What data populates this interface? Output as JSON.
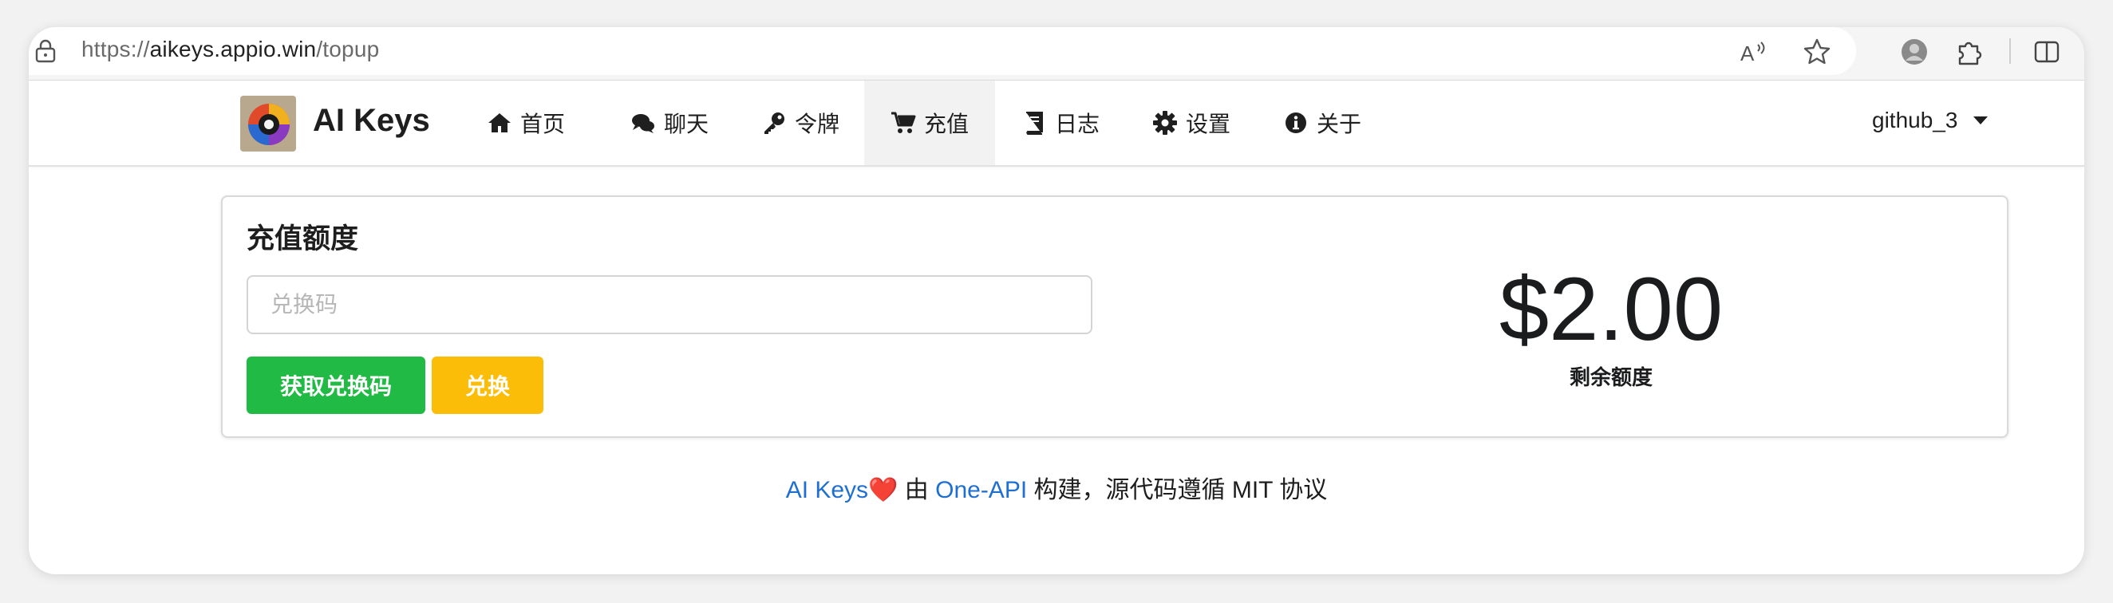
{
  "browser": {
    "url_scheme": "https://",
    "url_host": "aikeys.appio.win",
    "url_path": "/topup",
    "icons": [
      "lock-icon",
      "read-aloud-icon",
      "favorite-star-icon",
      "profile-avatar-icon",
      "extensions-icon",
      "split-view-icon"
    ]
  },
  "nav": {
    "brand": "AI Keys",
    "items": [
      {
        "label": "首页",
        "icon": "home-icon"
      },
      {
        "label": "聊天",
        "icon": "chat-icon"
      },
      {
        "label": "令牌",
        "icon": "key-icon"
      },
      {
        "label": "充值",
        "icon": "cart-icon"
      },
      {
        "label": "日志",
        "icon": "book-icon"
      },
      {
        "label": "设置",
        "icon": "gear-icon"
      },
      {
        "label": "关于",
        "icon": "info-icon"
      }
    ],
    "user": "github_3"
  },
  "topup": {
    "title": "充值额度",
    "input_placeholder": "兑换码",
    "input_value": "",
    "get_code_button": "获取兑换码",
    "redeem_button": "兑换",
    "balance": "$2.00",
    "balance_label": "剩余额度"
  },
  "footer": {
    "brand_link": "AI Keys",
    "heart": "❤️",
    "text_by": "由",
    "project_link": "One-API",
    "text_rest": "构建，源代码遵循 MIT 协议"
  },
  "colors": {
    "green": "#21ba45",
    "yellow": "#fbbd08",
    "link": "#1f6fd1"
  }
}
